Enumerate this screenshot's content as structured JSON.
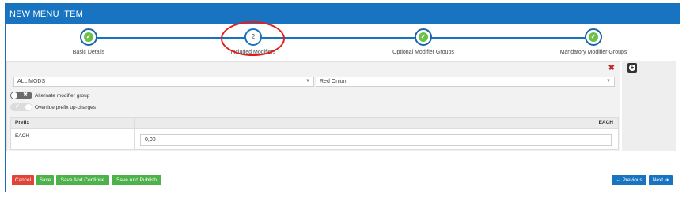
{
  "window": {
    "title": "NEW MENU ITEM"
  },
  "wizard": {
    "steps": [
      {
        "label": "Basic Details",
        "state": "complete"
      },
      {
        "label": "Included Modifiers",
        "state": "current",
        "number": "2"
      },
      {
        "label": "Optional Modifier Groups",
        "state": "complete"
      },
      {
        "label": "Mandatory Modifier Groups",
        "state": "complete"
      }
    ],
    "check_glyph": "✓"
  },
  "modifier": {
    "group_select": "ALL MODS",
    "modifier_select": "Red Onion",
    "caret": "▼",
    "remove_glyph": "✖",
    "alternate_toggle": {
      "label": "Alternate modifier group",
      "state": "off",
      "mark": "✖"
    },
    "override_toggle": {
      "label": "Override prefix up-charges",
      "state": "on",
      "mark": "✓"
    },
    "table": {
      "col_prefix": "Prefix",
      "col_each": "EACH",
      "row_label": "EACH",
      "row_value": "0,00"
    }
  },
  "side": {
    "add_glyph": "+"
  },
  "footer": {
    "cancel": "Cancel",
    "save": "Save",
    "save_continue": "Save And Continue",
    "save_publish": "Save And Publish",
    "previous": "← Previous",
    "next": "Next ➔"
  },
  "colors": {
    "brand_blue": "#1874c1",
    "check_green": "#6cc04a",
    "cancel_red": "#e0453a",
    "save_green": "#4db24a",
    "highlight_red": "#e01e1e"
  }
}
